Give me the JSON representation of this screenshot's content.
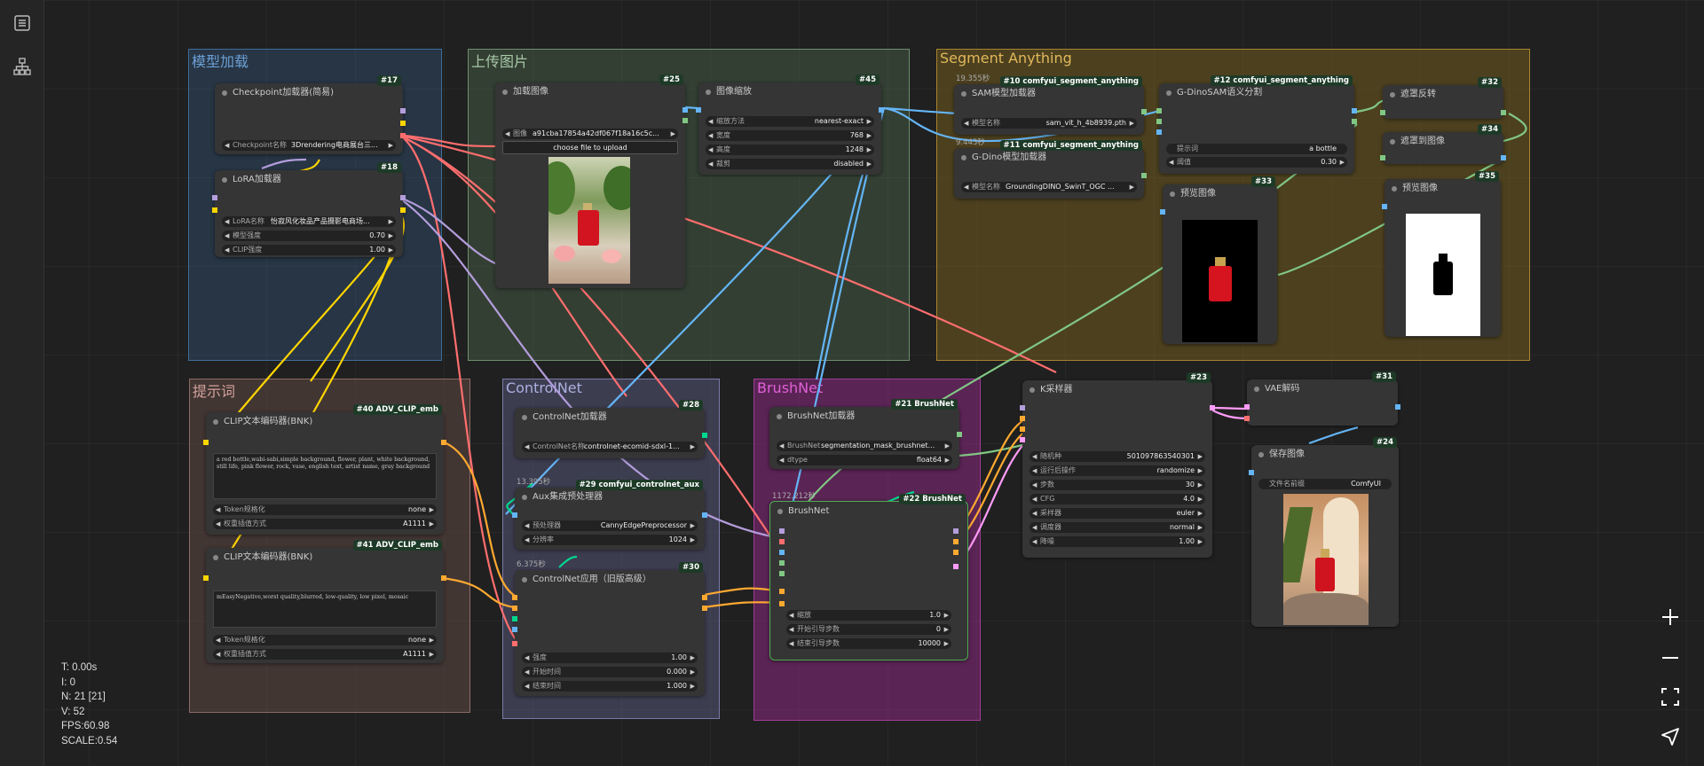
{
  "sidebar": {
    "queue_icon": "list-icon",
    "graph_icon": "node-tree-icon"
  },
  "groups": {
    "model_load": "模型加载",
    "upload": "上传图片",
    "segment": "Segment Anything",
    "prompt": "提示词",
    "controlnet": "ControlNet",
    "brushnet": "BrushNet"
  },
  "nodes": {
    "checkpoint": {
      "title": "Checkpoint加载器(简易)",
      "tag": "#17",
      "w_label": "Checkpoint名称",
      "w_value": "3Drendering电商展台三..."
    },
    "lora": {
      "title": "LoRA加载器",
      "tag": "#18",
      "w1_label": "LoRA名称",
      "w1_value": "怡寂风化妆品产品摄影电商场...",
      "w2_label": "模型强度",
      "w2_value": "0.70",
      "w3_label": "CLIP强度",
      "w3_value": "1.00"
    },
    "load_image": {
      "title": "加载图像",
      "tag": "#25",
      "w_label": "图像",
      "w_value": "a91cba17854a42df067f18a16c5c...",
      "button": "choose file to upload"
    },
    "image_scale": {
      "title": "图像缩放",
      "tag": "#45",
      "w1_label": "缩放方法",
      "w1_value": "nearest-exact",
      "w2_label": "宽度",
      "w2_value": "768",
      "w3_label": "高度",
      "w3_value": "1248",
      "w4_label": "裁剪",
      "w4_value": "disabled"
    },
    "sam_loader": {
      "title": "SAM模型加载器",
      "tag": "#10 comfyui_segment_anything",
      "time": "19.355秒",
      "w_label": "模型名称",
      "w_value": "sam_vit_h_4b8939.pth"
    },
    "gdino_loader": {
      "title": "G-Dino模型加载器",
      "tag": "#11 comfyui_segment_anything",
      "time": "9.443秒",
      "w_label": "模型名称",
      "w_value": "GroundingDINO_SwinT_OGC ..."
    },
    "gdino_sam": {
      "title": "G-DinoSAM语义分割",
      "tag": "#12 comfyui_segment_anything",
      "w1_label": "提示词",
      "w1_value": "a bottle",
      "w2_label": "阈值",
      "w2_value": "0.30"
    },
    "mask_invert": {
      "title": "遮罩反转",
      "tag": "#32"
    },
    "mask_to_image": {
      "title": "遮罩到图像",
      "tag": "#34"
    },
    "preview1": {
      "title": "预览图像",
      "tag": "#33"
    },
    "preview2": {
      "title": "预览图像",
      "tag": "#35"
    },
    "clip_pos": {
      "title": "CLIP文本编码器(BNK)",
      "tag": "#40 ADV_CLIP_emb",
      "text": "a red bottle,wabi-sabi,simple background, flower, plant, white background, still life, pink flower, rock, vase, english text, artist name, gray background",
      "w1_label": "Token规格化",
      "w1_value": "none",
      "w2_label": "权重插值方式",
      "w2_value": "A1111"
    },
    "clip_neg": {
      "title": "CLIP文本编码器(BNK)",
      "tag": "#41 ADV_CLIP_emb",
      "text": "mEasyNegative,worst quality,blurred, low-quality, low pixel, mosaic",
      "w1_label": "Token规格化",
      "w1_value": "none",
      "w2_label": "权重插值方式",
      "w2_value": "A1111"
    },
    "controlnet_loader": {
      "title": "ControlNet加载器",
      "tag": "#28",
      "w_label": "ControlNet名称",
      "w_value": "controlnet-ecomid-sdxl-1..."
    },
    "aux_pre": {
      "title": "Aux集成预处理器",
      "tag": "#29 comfyui_controlnet_aux",
      "time": "13.395秒",
      "w1_label": "预处理器",
      "w1_value": "CannyEdgePreprocessor",
      "w2_label": "分辨率",
      "w2_value": "1024"
    },
    "cn_apply": {
      "title": "ControlNet应用（旧版高级）",
      "tag": "#30",
      "time": "6.375秒",
      "w1_label": "强度",
      "w1_value": "1.00",
      "w2_label": "开始时间",
      "w2_value": "0.000",
      "w3_label": "结束时间",
      "w3_value": "1.000"
    },
    "brushnet_loader": {
      "title": "BrushNet加载器",
      "tag": "#21 BrushNet",
      "w1_label": "BrushNet",
      "w1_value": "segmentation_mask_brushnet...",
      "w2_label": "dtype",
      "w2_value": "float64"
    },
    "brushnet": {
      "title": "BrushNet",
      "tag": "#22 BrushNet",
      "time": "1172.212秒",
      "w1_label": "缩放",
      "w1_value": "1.0",
      "w2_label": "开始引导步数",
      "w2_value": "0",
      "w3_label": "结束引导步数",
      "w3_value": "10000"
    },
    "ksampler": {
      "title": "K采样器",
      "tag": "#23",
      "w1_label": "随机种",
      "w1_value": "501097863540301",
      "w2_label": "运行后操作",
      "w2_value": "randomize",
      "w3_label": "步数",
      "w3_value": "30",
      "w4_label": "CFG",
      "w4_value": "4.0",
      "w5_label": "采样器",
      "w5_value": "euler",
      "w6_label": "调度器",
      "w6_value": "normal",
      "w7_label": "降噪",
      "w7_value": "1.00"
    },
    "vae_decode": {
      "title": "VAE解码",
      "tag": "#31"
    },
    "save_image": {
      "title": "保存图像",
      "tag": "#24",
      "w_label": "文件名前缀",
      "w_value": "ComfyUI"
    }
  },
  "stats": {
    "t": "T: 0.00s",
    "i": "I: 0",
    "n": "N: 21 [21]",
    "v": "V: 52",
    "fps": "FPS:60.98",
    "scale": "SCALE:0.54"
  },
  "controls": {
    "zoom_in": "plus-icon",
    "zoom_out": "minus-icon",
    "fit": "fit-view-icon",
    "locate": "navigate-icon"
  },
  "colors": {
    "model": "#b39ddb",
    "clip": "#ffd500",
    "image": "#64b5f6",
    "mask": "#81c784",
    "conditioning": "#ffa931",
    "latent": "#ff9cf9",
    "vae": "#ff6e6e"
  }
}
